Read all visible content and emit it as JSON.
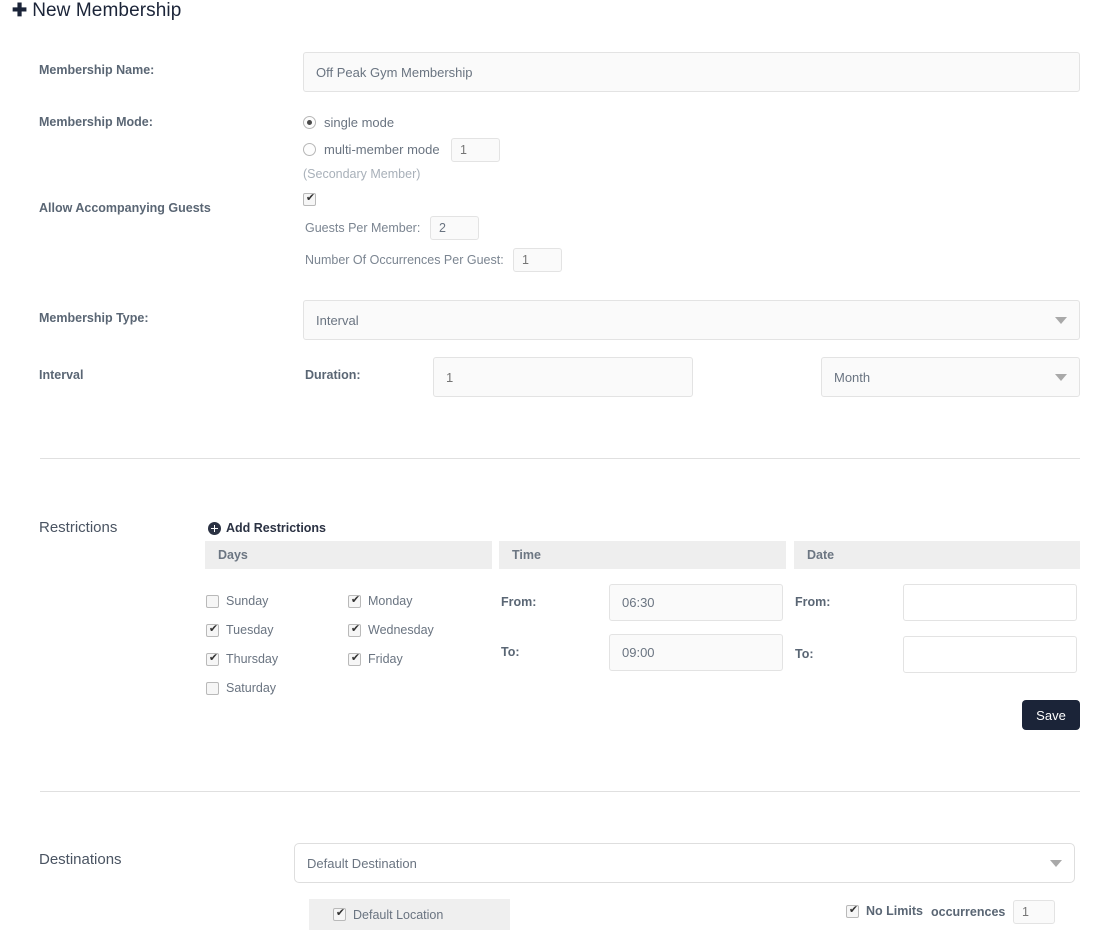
{
  "page": {
    "plus_icon": "plus-icon",
    "title": "New Membership"
  },
  "form": {
    "membership_name": {
      "label": "Membership Name:",
      "value": "Off Peak Gym Membership"
    },
    "membership_mode": {
      "label": "Membership Mode:",
      "single_label": "single mode",
      "multi_label": "multi-member mode",
      "multi_count_placeholder": "1",
      "secondary_note": "(Secondary Member)"
    },
    "guests": {
      "label": "Allow Accompanying Guests",
      "enabled": true,
      "per_member_label": "Guests Per Member:",
      "per_member_value": "2",
      "occurrences_label": "Number Of Occurrences Per Guest:",
      "occurrences_placeholder": "1"
    },
    "membership_type": {
      "label": "Membership Type:",
      "selected": "Interval"
    },
    "interval": {
      "label": "Interval",
      "duration_label": "Duration:",
      "duration_placeholder": "1",
      "unit_selected": "Month"
    }
  },
  "restrictions": {
    "section_title": "Restrictions",
    "add_link": "Add Restrictions",
    "columns": {
      "days": "Days",
      "time": "Time",
      "date": "Date"
    },
    "days": [
      {
        "label": "Sunday",
        "checked": false
      },
      {
        "label": "Monday",
        "checked": true
      },
      {
        "label": "Tuesday",
        "checked": true
      },
      {
        "label": "Wednesday",
        "checked": true
      },
      {
        "label": "Thursday",
        "checked": true
      },
      {
        "label": "Friday",
        "checked": true
      },
      {
        "label": "Saturday",
        "checked": false
      }
    ],
    "time": {
      "from_label": "From:",
      "from_value": "06:30",
      "to_label": "To:",
      "to_value": "09:00"
    },
    "date": {
      "from_label": "From:",
      "from_value": "",
      "to_label": "To:",
      "to_value": ""
    },
    "save_label": "Save"
  },
  "destinations": {
    "section_title": "Destinations",
    "selected": "Default Destination",
    "location_label": "Default Location",
    "location_checked": true,
    "no_limits_label": "No Limits",
    "no_limits_checked": true,
    "occurrences_label": "occurrences",
    "occurrences_placeholder": "1"
  },
  "colors": {
    "accent_dark": "#1b2438",
    "label": "#5a6674",
    "input_bg": "#fafafa",
    "header_bar": "#eeeeee"
  }
}
